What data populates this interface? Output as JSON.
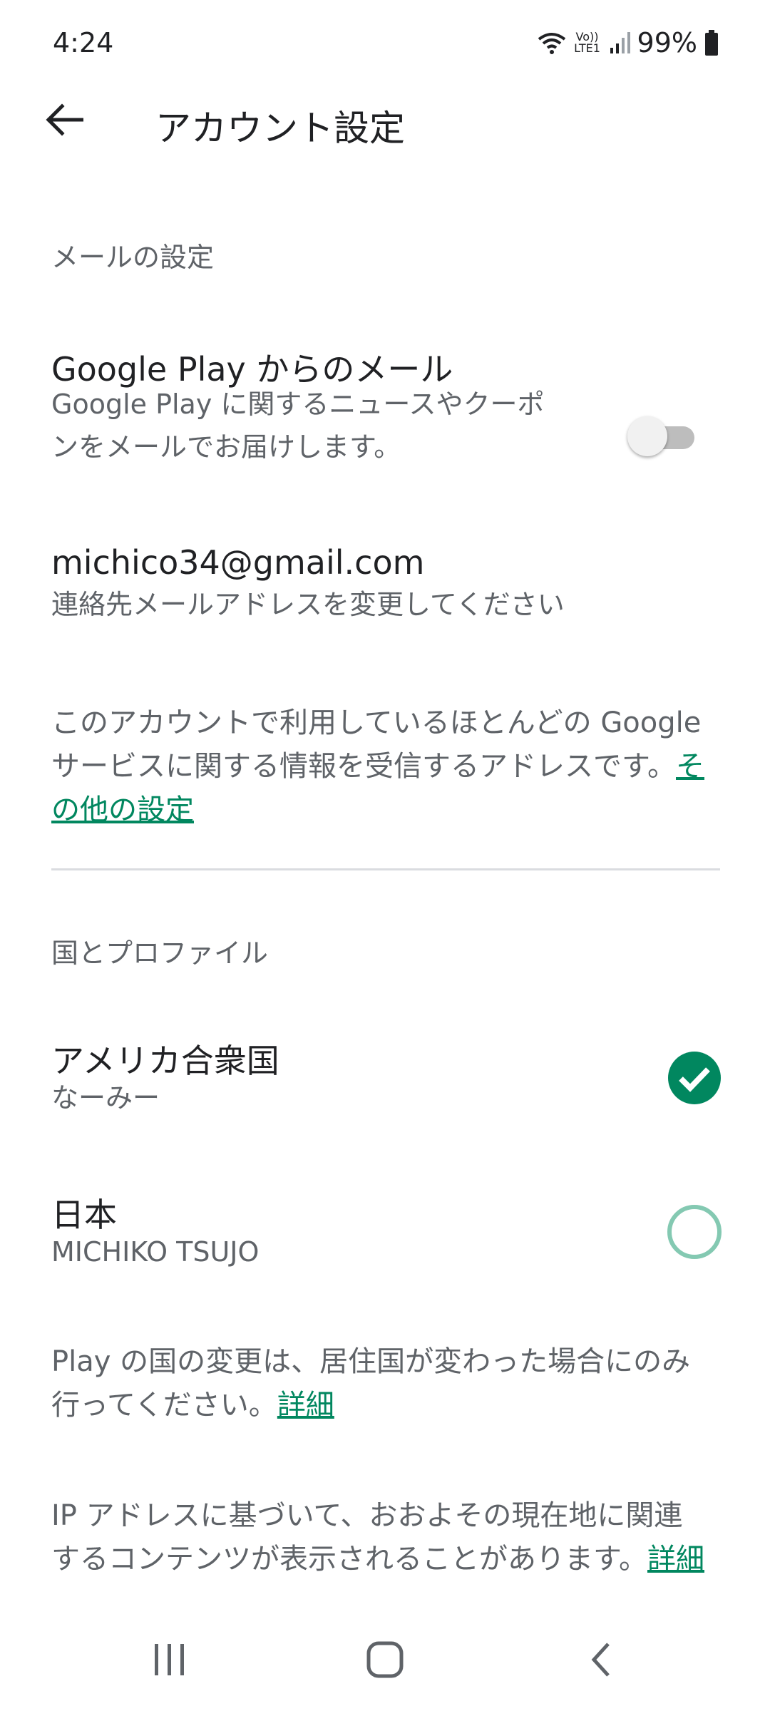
{
  "status_bar": {
    "time": "4:24",
    "network_label": "Vo)) LTE1",
    "battery": "99%"
  },
  "app_bar": {
    "back_icon": "arrow-left-icon",
    "title": "アカウント設定"
  },
  "email_section": {
    "header": "メールの設定",
    "google_play_mail": {
      "title": "Google Play からのメール",
      "subtitle_line1": "Google Play に関するニュースやクーポ",
      "subtitle_line2": "ンをメールでお届けします。",
      "enabled": false
    },
    "contact_email": {
      "address": "michico34@gmail.com",
      "subtitle": "連絡先メールアドレスを変更してください"
    },
    "info_line1": "このアカウントで利用しているほとんどの Google",
    "info_line2": "サービスに関する情報を受信するアドレスです。",
    "info_link_part1": "そ",
    "info_link_part2": "の他の設定"
  },
  "country_section": {
    "header": "国とプロファイル",
    "profiles": [
      {
        "country": "アメリカ合衆国",
        "name": "なーみー",
        "selected": true
      },
      {
        "country": "日本",
        "name": "MICHIKO TSUJO",
        "selected": false
      }
    ],
    "change_note_line1": "Play の国の変更は、居住国が変わった場合にのみ",
    "change_note_line2": "行ってください。",
    "change_note_link": "詳細",
    "ip_note_line1": "IP アドレスに基づいて、おおよその現在地に関連",
    "ip_note_line2": "するコンテンツが表示されることがあります。",
    "ip_note_link": "詳細"
  },
  "colors": {
    "accent": "#01875f",
    "accent_light": "#84c9b2",
    "text_primary": "#202124",
    "text_secondary": "#5f6368",
    "divider": "#dadce0"
  },
  "nav_bar": {
    "icons": [
      "recent-apps-icon",
      "home-icon",
      "back-icon"
    ]
  }
}
